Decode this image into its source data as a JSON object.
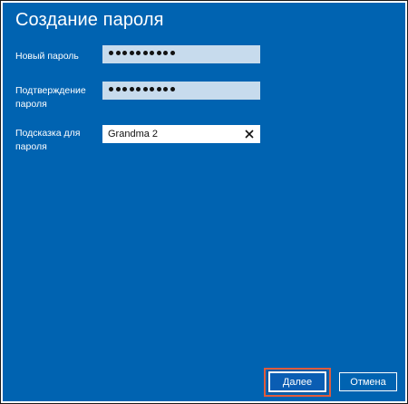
{
  "dialog": {
    "title": "Создание пароля"
  },
  "fields": {
    "new_password": {
      "label": "Новый пароль",
      "masked_length": 10
    },
    "confirm_password": {
      "label": "Подтверждение\nпароля",
      "masked_length": 10
    },
    "hint": {
      "label": "Подсказка для\nпароля",
      "value": "Grandma 2",
      "clear_icon": "close-icon"
    }
  },
  "buttons": {
    "next_label": "Далее",
    "cancel_label": "Отмена"
  },
  "colors": {
    "background": "#0063b1",
    "highlight_border": "#e05b3c",
    "field_inactive": "#c7dbed",
    "field_active": "#ffffff"
  }
}
